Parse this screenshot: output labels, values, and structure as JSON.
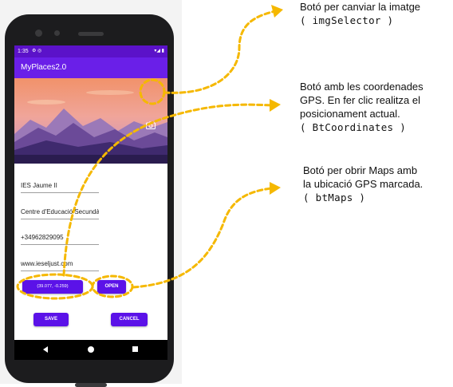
{
  "status_bar": {
    "time": "1:35",
    "left_icons": "⚙ ◎",
    "right_icons": "▾◢ ▮"
  },
  "app": {
    "title": "MyPlaces2.0"
  },
  "form": {
    "name": "IES Jaume II",
    "description": "Centre d'Educació Secundària",
    "phone": "+34962829095",
    "website": "www.ieseljust.com"
  },
  "buttons": {
    "coordinates": "(39.077, -0.259)",
    "maps": "OPEN",
    "save": "SAVE",
    "cancel": "CANCEL"
  },
  "annotations": {
    "img_selector": {
      "line1": "Botó per canviar la imatge",
      "code": "( imgSelector )"
    },
    "bt_coordinates": {
      "line1": "Botó amb les coordenades",
      "line2": "GPS. En fer clic realitza el",
      "line3": "posicionament actual.",
      "code": "( BtCoordinates )"
    },
    "bt_maps": {
      "line1": "Botó per obrir Maps amb",
      "line2": "la ubicació GPS marcada.",
      "code": "( btMaps )"
    }
  },
  "colors": {
    "status_bar": "#5b12c9",
    "app_bar": "#6a1fe8",
    "button": "#5b12e8",
    "annotation_accent": "#f5b800"
  },
  "icons": [
    "camera-icon",
    "settings-icon",
    "wifi-icon",
    "battery-icon",
    "back-icon",
    "home-icon",
    "recents-icon"
  ]
}
